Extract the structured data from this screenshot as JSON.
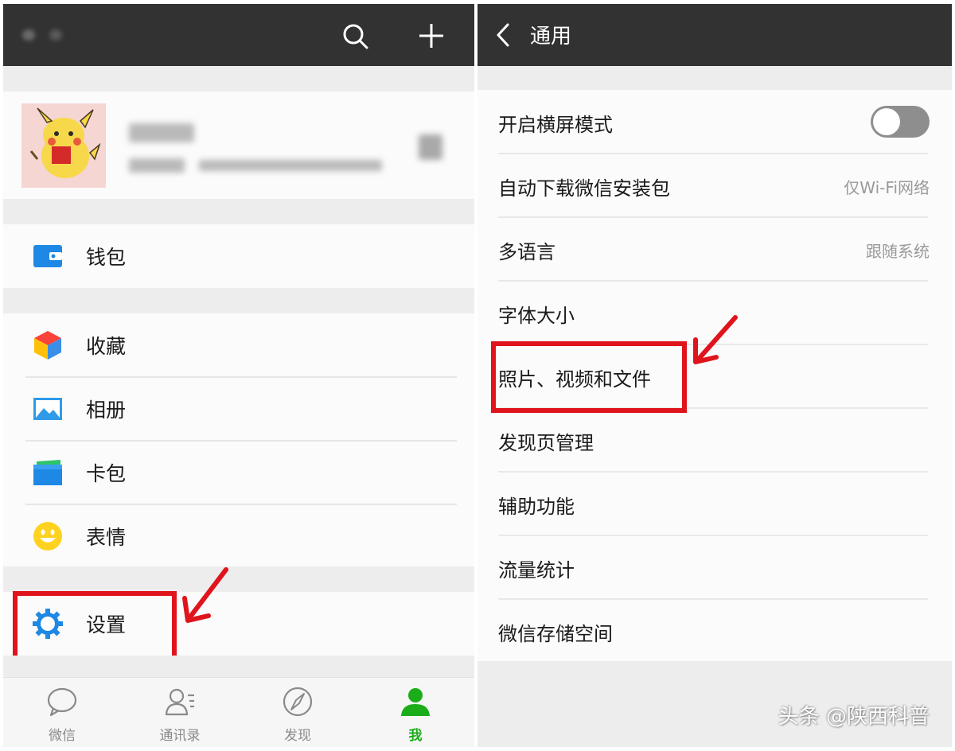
{
  "left": {
    "menu": {
      "wallet": "钱包",
      "favorites": "收藏",
      "album": "相册",
      "cards": "卡包",
      "stickers": "表情",
      "settings": "设置"
    },
    "tabs": [
      {
        "label": "微信",
        "icon": "chat-bubble-icon"
      },
      {
        "label": "通讯录",
        "icon": "contacts-icon"
      },
      {
        "label": "发现",
        "icon": "compass-icon"
      },
      {
        "label": "我",
        "icon": "person-icon",
        "active": true
      }
    ]
  },
  "right": {
    "title": "通用",
    "items": [
      {
        "label": "开启横屏模式",
        "toggle": false
      },
      {
        "label": "自动下载微信安装包",
        "value": "仅Wi-Fi网络"
      },
      {
        "label": "多语言",
        "value": "跟随系统"
      },
      {
        "label": "字体大小"
      },
      {
        "label": "照片、视频和文件"
      },
      {
        "label": "发现页管理"
      },
      {
        "label": "辅助功能"
      },
      {
        "label": "流量统计"
      },
      {
        "label": "微信存储空间"
      }
    ]
  },
  "watermark": "头条 @陕西科普",
  "colors": {
    "titlebar": "#323233",
    "highlight": "#e0141c",
    "active_tab": "#1aad19",
    "wallet": "#1e88e5"
  }
}
